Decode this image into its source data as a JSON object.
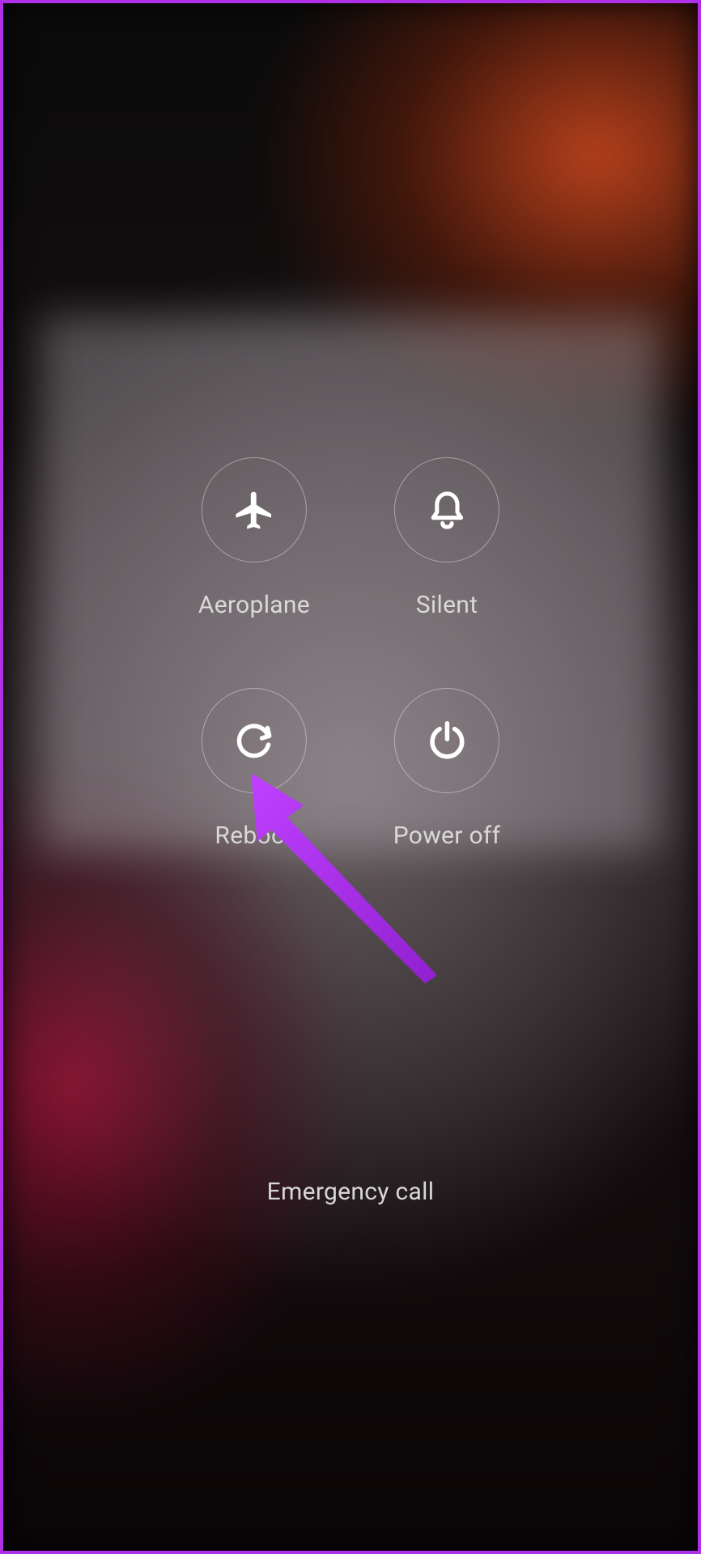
{
  "powerMenu": {
    "buttons": [
      {
        "id": "aeroplane",
        "label": "Aeroplane",
        "icon": "airplane-icon"
      },
      {
        "id": "silent",
        "label": "Silent",
        "icon": "bell-icon"
      },
      {
        "id": "reboot",
        "label": "Reboot",
        "icon": "restart-icon"
      },
      {
        "id": "poweroff",
        "label": "Power off",
        "icon": "power-icon"
      }
    ]
  },
  "emergencyCall": {
    "label": "Emergency call"
  },
  "annotation": {
    "color": "#b030e8",
    "target": "reboot"
  }
}
